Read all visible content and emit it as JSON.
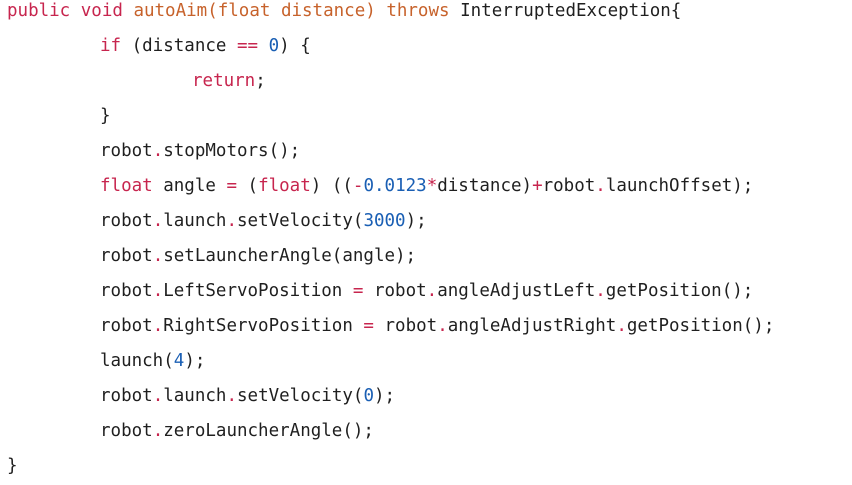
{
  "code_lines": [
    {
      "id": "line-1",
      "tokens": [
        {
          "c": "kw",
          "t": "public void "
        },
        {
          "c": "fn",
          "t": "autoAim"
        },
        {
          "c": "fn",
          "t": "(float distance) "
        },
        {
          "c": "fn",
          "t": "throws"
        },
        {
          "c": "type",
          "t": " InterruptedException{"
        }
      ]
    },
    {
      "id": "line-2",
      "tokens": [
        {
          "c": "kw",
          "t": "if"
        },
        {
          "c": "type",
          "t": " (distance "
        },
        {
          "c": "op",
          "t": "=="
        },
        {
          "c": "type",
          "t": " "
        },
        {
          "c": "num",
          "t": "0"
        },
        {
          "c": "type",
          "t": ") {"
        }
      ]
    },
    {
      "id": "line-3",
      "tokens": [
        {
          "c": "kw",
          "t": "return"
        },
        {
          "c": "type",
          "t": ";"
        }
      ]
    },
    {
      "id": "line-4",
      "tokens": [
        {
          "c": "type",
          "t": "}"
        }
      ]
    },
    {
      "id": "line-5",
      "tokens": [
        {
          "c": "type",
          "t": "robot"
        },
        {
          "c": "op",
          "t": "."
        },
        {
          "c": "type",
          "t": "stopMotors();"
        }
      ]
    },
    {
      "id": "line-6",
      "tokens": [
        {
          "c": "kw",
          "t": "float"
        },
        {
          "c": "type",
          "t": " angle "
        },
        {
          "c": "op",
          "t": "="
        },
        {
          "c": "type",
          "t": " ("
        },
        {
          "c": "kw",
          "t": "float"
        },
        {
          "c": "type",
          "t": ") (("
        },
        {
          "c": "op",
          "t": "-"
        },
        {
          "c": "num",
          "t": "0.0123"
        },
        {
          "c": "op",
          "t": "*"
        },
        {
          "c": "type",
          "t": "distance)"
        },
        {
          "c": "op",
          "t": "+"
        },
        {
          "c": "type",
          "t": "robot"
        },
        {
          "c": "op",
          "t": "."
        },
        {
          "c": "type",
          "t": "launchOffset);"
        }
      ]
    },
    {
      "id": "line-7",
      "tokens": [
        {
          "c": "type",
          "t": "robot"
        },
        {
          "c": "op",
          "t": "."
        },
        {
          "c": "type",
          "t": "launch"
        },
        {
          "c": "op",
          "t": "."
        },
        {
          "c": "type",
          "t": "setVelocity("
        },
        {
          "c": "num",
          "t": "3000"
        },
        {
          "c": "type",
          "t": ");"
        }
      ]
    },
    {
      "id": "line-8",
      "tokens": [
        {
          "c": "type",
          "t": "robot"
        },
        {
          "c": "op",
          "t": "."
        },
        {
          "c": "type",
          "t": "setLauncherAngle(angle);"
        }
      ]
    },
    {
      "id": "line-9",
      "tokens": [
        {
          "c": "type",
          "t": "robot"
        },
        {
          "c": "op",
          "t": "."
        },
        {
          "c": "type",
          "t": "LeftServoPosition "
        },
        {
          "c": "op",
          "t": "="
        },
        {
          "c": "type",
          "t": " robot"
        },
        {
          "c": "op",
          "t": "."
        },
        {
          "c": "type",
          "t": "angleAdjustLeft"
        },
        {
          "c": "op",
          "t": "."
        },
        {
          "c": "type",
          "t": "getPosition();"
        }
      ]
    },
    {
      "id": "line-10",
      "tokens": [
        {
          "c": "type",
          "t": "robot"
        },
        {
          "c": "op",
          "t": "."
        },
        {
          "c": "type",
          "t": "RightServoPosition "
        },
        {
          "c": "op",
          "t": "="
        },
        {
          "c": "type",
          "t": " robot"
        },
        {
          "c": "op",
          "t": "."
        },
        {
          "c": "type",
          "t": "angleAdjustRight"
        },
        {
          "c": "op",
          "t": "."
        },
        {
          "c": "type",
          "t": "getPosition();"
        }
      ]
    },
    {
      "id": "line-11",
      "tokens": [
        {
          "c": "type",
          "t": "launch("
        },
        {
          "c": "num",
          "t": "4"
        },
        {
          "c": "type",
          "t": ");"
        }
      ]
    },
    {
      "id": "line-12",
      "tokens": [
        {
          "c": "type",
          "t": "robot"
        },
        {
          "c": "op",
          "t": "."
        },
        {
          "c": "type",
          "t": "launch"
        },
        {
          "c": "op",
          "t": "."
        },
        {
          "c": "type",
          "t": "setVelocity("
        },
        {
          "c": "num",
          "t": "0"
        },
        {
          "c": "type",
          "t": ");"
        }
      ]
    },
    {
      "id": "line-13",
      "tokens": [
        {
          "c": "type",
          "t": "robot"
        },
        {
          "c": "op",
          "t": "."
        },
        {
          "c": "type",
          "t": "zeroLauncherAngle();"
        }
      ]
    },
    {
      "id": "line-14",
      "tokens": [
        {
          "c": "type",
          "t": "}"
        }
      ]
    }
  ]
}
